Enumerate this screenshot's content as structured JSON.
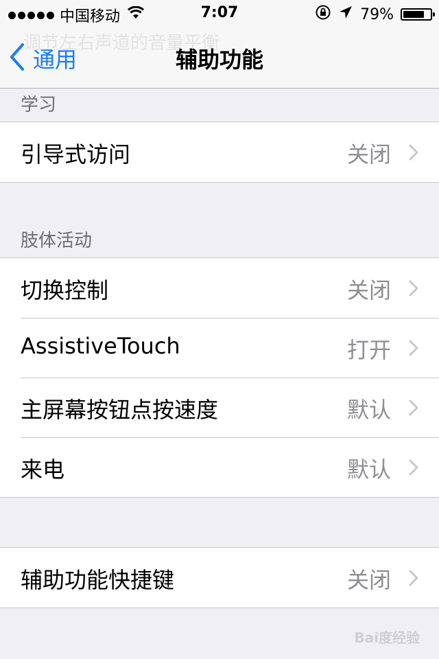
{
  "status_bar": {
    "carrier": "中国移动",
    "time": "7:07",
    "battery": "79%",
    "battery_level": 0.79
  },
  "nav": {
    "ghost_text": "调节左右声道的音量平衡",
    "back_label": "通用",
    "title": "辅助功能"
  },
  "sections": {
    "learning": {
      "header": "学习",
      "rows": [
        {
          "title": "引导式访问",
          "value": "关闭"
        }
      ]
    },
    "motor": {
      "header": "肢体活动",
      "rows": [
        {
          "title": "切换控制",
          "value": "关闭"
        },
        {
          "title": "AssistiveTouch",
          "value": "打开"
        },
        {
          "title": "主屏幕按钮点按速度",
          "value": "默认"
        },
        {
          "title": "来电",
          "value": "默认"
        }
      ]
    },
    "shortcut": {
      "rows": [
        {
          "title": "辅助功能快捷键",
          "value": "关闭"
        }
      ]
    }
  },
  "watermark": "Bai度经验",
  "colors": {
    "accent": "#1a7cf5",
    "background": "#efeff4",
    "secondary_text": "#8e8e93"
  },
  "icons": [
    "wifi-icon",
    "orientation-lock-icon",
    "location-arrow-icon",
    "battery-icon",
    "chevron-left-icon",
    "chevron-right-icon"
  ]
}
